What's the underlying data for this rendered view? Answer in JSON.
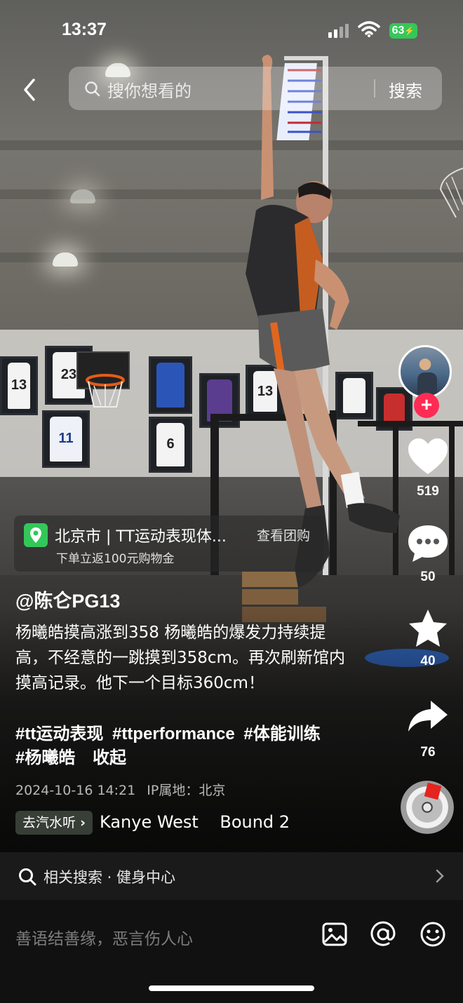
{
  "status_bar": {
    "time": "13:37",
    "battery": "63"
  },
  "search": {
    "placeholder": "搜你想看的",
    "button": "搜索"
  },
  "scene": {
    "jerseys": [
      "13",
      "23",
      "11",
      "6",
      "13"
    ]
  },
  "location": {
    "title": "北京市 | TT运动表现体...",
    "cta": "查看团购",
    "subtitle": "下单立返100元购物金"
  },
  "post": {
    "author": "@陈仑PG13",
    "description": "杨曦皓摸高涨到358 杨曦皓的爆发力持续提高，不经意的一跳摸到358cm。再次刷新馆内摸高记录。他下一个目标360cm！",
    "hashtags": [
      "#tt运动表现",
      "#ttperformance",
      "#体能训练",
      "#杨曦皓"
    ],
    "collapse": "收起",
    "datetime": "2024-10-16 14:21",
    "ip_location": "IP属地：北京"
  },
  "music": {
    "button": "去汽水听",
    "track": "Kanye West    Bound 2"
  },
  "actions": {
    "likes": "519",
    "comments": "50",
    "favorites": "40",
    "shares": "76"
  },
  "related": {
    "text": "相关搜索 · 健身中心"
  },
  "comment_bar": {
    "placeholder": "善语结善缘，恶言伤人心"
  },
  "colors": {
    "like_accent": "#fe2c55",
    "location_pin": "#33c759",
    "battery": "#34c759"
  }
}
